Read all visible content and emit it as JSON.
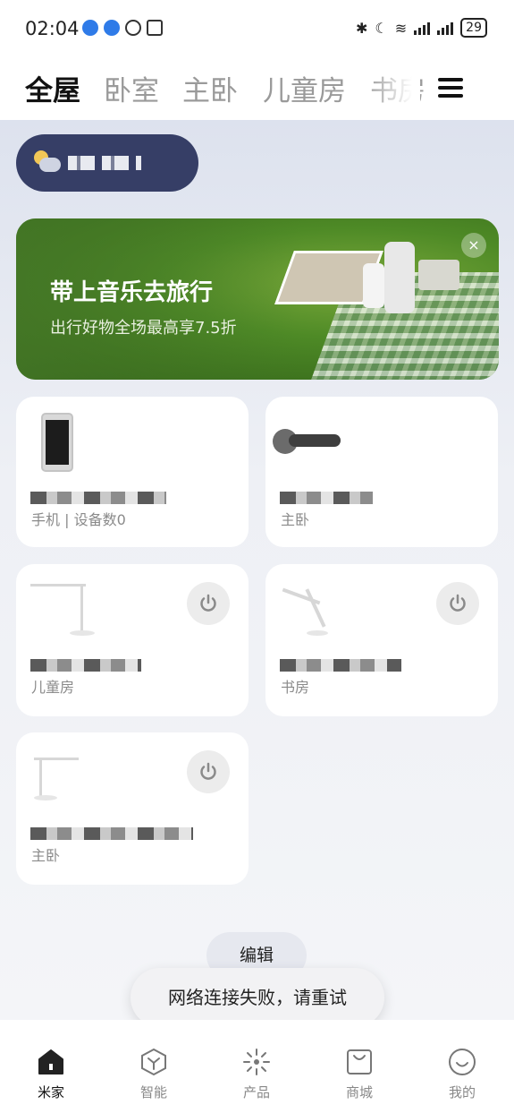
{
  "status_bar": {
    "time": "02:04",
    "battery": "29"
  },
  "tabs": [
    {
      "label": "全屋",
      "active": true
    },
    {
      "label": "卧室",
      "active": false
    },
    {
      "label": "主卧",
      "active": false
    },
    {
      "label": "儿童房",
      "active": false
    },
    {
      "label": "书房",
      "active": false
    }
  ],
  "banner": {
    "title": "带上音乐去旅行",
    "subtitle": "出行好物全场最高享7.5折",
    "close_icon": "×"
  },
  "devices": [
    {
      "room": "手机 | 设备数0",
      "icon": "phone-icon",
      "has_power": false
    },
    {
      "room": "主卧",
      "icon": "door-lock-icon",
      "has_power": false
    },
    {
      "room": "儿童房",
      "icon": "desk-lamp-icon",
      "has_power": true
    },
    {
      "room": "书房",
      "icon": "desk-lamp-icon",
      "has_power": true
    },
    {
      "room": "主卧",
      "icon": "desk-lamp-icon",
      "has_power": true
    }
  ],
  "edit_button": "编辑",
  "toast": "网络连接失败，请重试",
  "bottom_nav": [
    {
      "label": "米家",
      "icon": "home-icon",
      "active": true
    },
    {
      "label": "智能",
      "icon": "smart-icon",
      "active": false
    },
    {
      "label": "产品",
      "icon": "product-icon",
      "active": false
    },
    {
      "label": "商城",
      "icon": "store-icon",
      "active": false
    },
    {
      "label": "我的",
      "icon": "profile-icon",
      "active": false
    }
  ],
  "colors": {
    "weather_pill": "#363e66",
    "banner_green": "#4e8a26",
    "power_button_bg": "#ececec"
  }
}
